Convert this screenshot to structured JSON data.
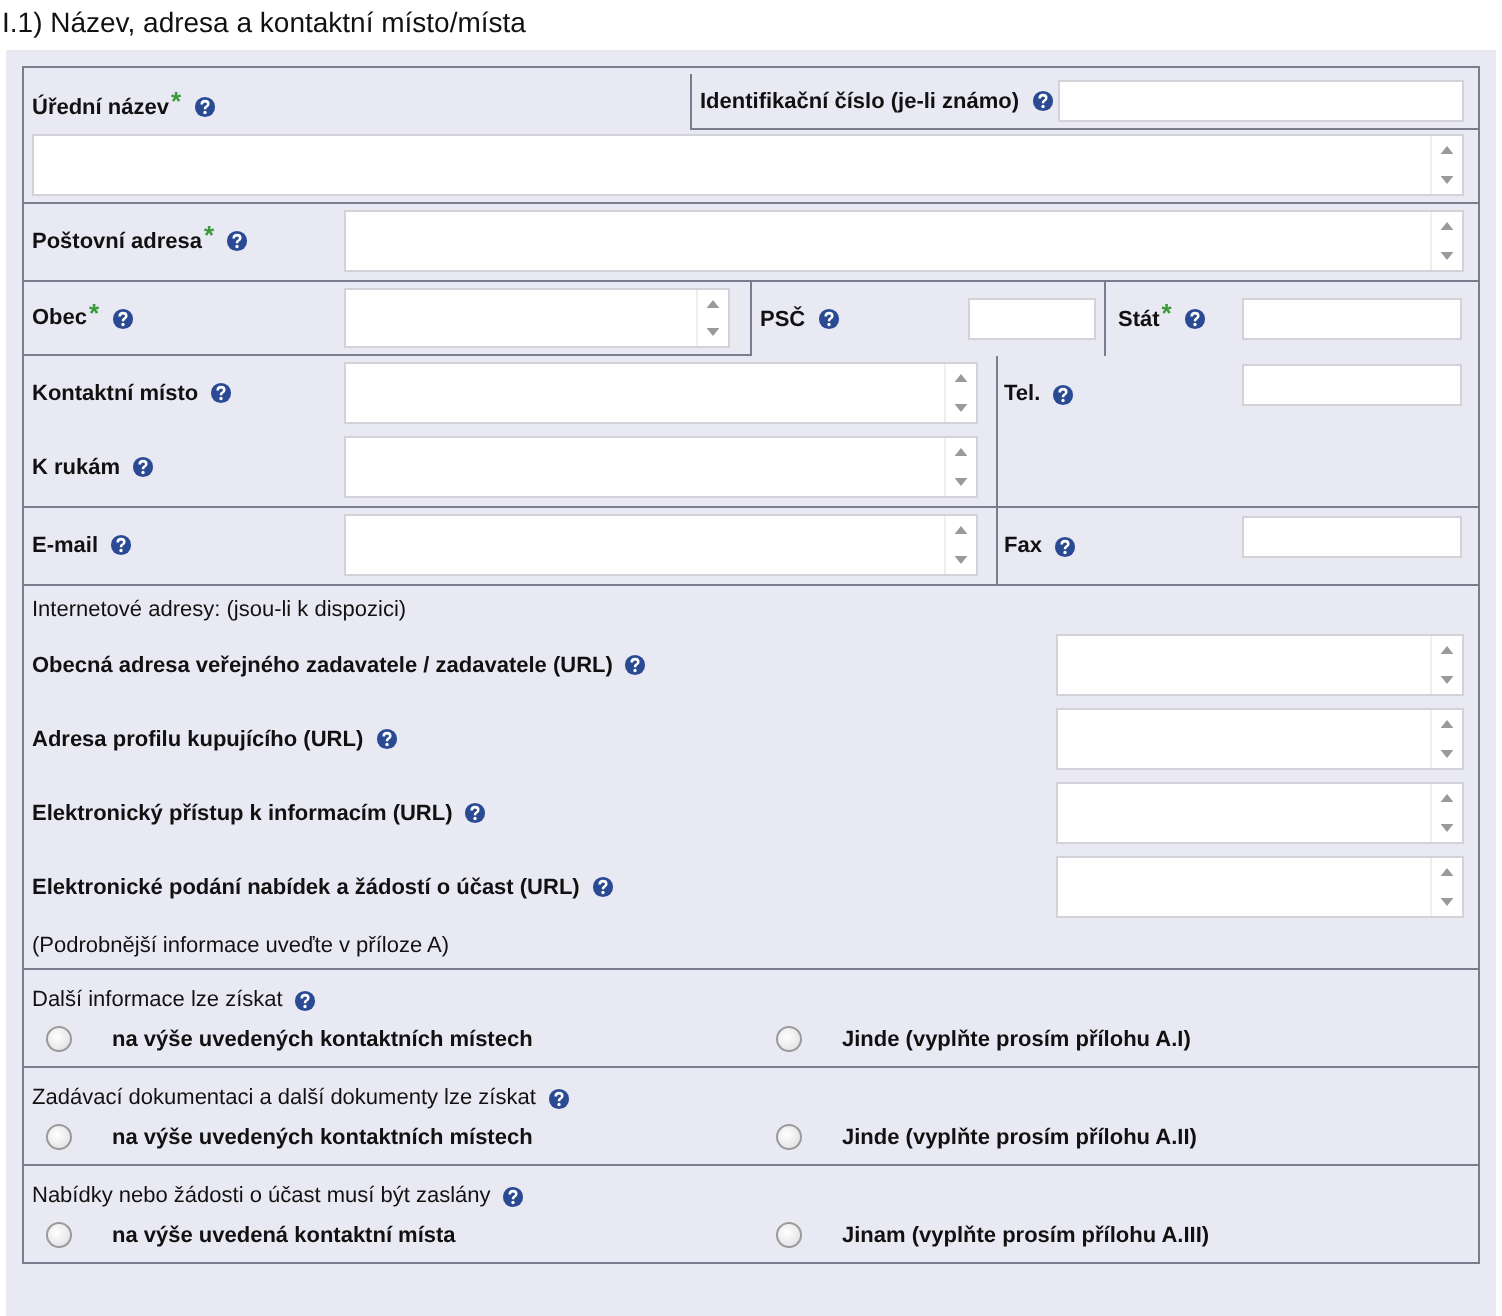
{
  "title": "I.1) Název, adresa a kontaktní místo/místa",
  "required_mark": "*",
  "official_name": {
    "label": "Úřední název",
    "required": true,
    "kind": "multiline"
  },
  "id_number": {
    "label": "Identifikační číslo (je-li známo)",
    "required": false,
    "kind": "single"
  },
  "postal_address": {
    "label": "Poštovní adresa",
    "required": true,
    "kind": "multiline"
  },
  "town": {
    "label": "Obec",
    "required": true,
    "kind": "multiline"
  },
  "postcode": {
    "label": "PSČ",
    "required": false,
    "kind": "single"
  },
  "country": {
    "label": "Stát",
    "required": true,
    "kind": "single"
  },
  "contact_point": {
    "label": "Kontaktní místo",
    "required": false,
    "kind": "multiline"
  },
  "attention": {
    "label": "K rukám",
    "required": false,
    "kind": "multiline"
  },
  "phone": {
    "label": "Tel.",
    "required": false,
    "kind": "single"
  },
  "email": {
    "label": "E-mail",
    "required": false,
    "kind": "multiline"
  },
  "fax": {
    "label": "Fax",
    "required": false,
    "kind": "single"
  },
  "internet": {
    "heading": "Internetové adresy: (jsou-li k dispozici)",
    "fields": [
      {
        "label": "Obecná adresa veřejného zadavatele / zadavatele (URL)",
        "kind": "multiline"
      },
      {
        "label": "Adresa profilu kupujícího (URL)",
        "kind": "multiline"
      },
      {
        "label": "Elektronický přístup k informacím (URL)",
        "kind": "multiline"
      },
      {
        "label": "Elektronické podání nabídek a žádostí o účast (URL)",
        "kind": "multiline"
      }
    ],
    "note": "(Podrobnější informace uveďte v příloze A)"
  },
  "questions": [
    {
      "question": "Další informace lze získat",
      "options": [
        {
          "label": "na výše uvedených kontaktních místech",
          "selected": false
        },
        {
          "label": "Jinde (vyplňte prosím přílohu A.I)",
          "selected": false
        }
      ]
    },
    {
      "question": "Zadávací dokumentaci a další dokumenty lze získat",
      "options": [
        {
          "label": "na výše uvedených kontaktních místech",
          "selected": false
        },
        {
          "label": "Jinde (vyplňte prosím přílohu A.II)",
          "selected": false
        }
      ]
    },
    {
      "question": "Nabídky nebo žádosti o účast musí být zaslány",
      "options": [
        {
          "label": "na výše uvedená kontaktní místa",
          "selected": false
        },
        {
          "label": "Jinam (vyplňte prosím přílohu A.III)",
          "selected": false
        }
      ]
    }
  ]
}
